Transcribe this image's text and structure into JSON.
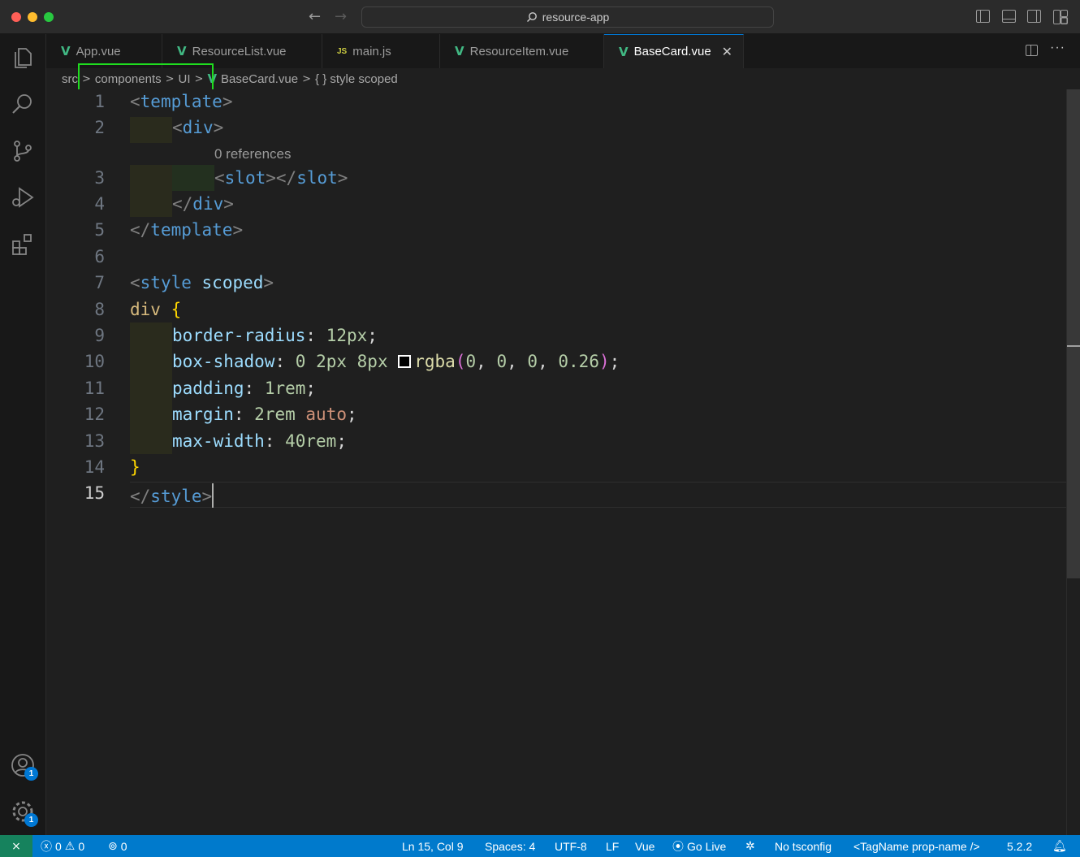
{
  "titlebar": {
    "search_text": "resource-app"
  },
  "tabs": [
    {
      "label": "App.vue",
      "icon": "vue"
    },
    {
      "label": "ResourceList.vue",
      "icon": "vue"
    },
    {
      "label": "main.js",
      "icon": "js"
    },
    {
      "label": "ResourceItem.vue",
      "icon": "vue"
    },
    {
      "label": "BaseCard.vue",
      "icon": "vue",
      "active": true
    }
  ],
  "icon_text": {
    "js": "JS",
    "close": "✕",
    "more": "···"
  },
  "breadcrumb": {
    "items": [
      "src",
      "components",
      "UI",
      "BaseCard.vue",
      "{ } style scoped"
    ],
    "separator": ">"
  },
  "editor": {
    "line_numbers": [
      "1",
      "2",
      "3",
      "4",
      "5",
      "6",
      "7",
      "8",
      "9",
      "10",
      "11",
      "12",
      "13",
      "14",
      "15"
    ],
    "current_line": "15",
    "codelens": "0 references",
    "tokens": {
      "lt": "<",
      "gt": ">",
      "lts": "</",
      "template": "template",
      "div": "div",
      "slot": "slot",
      "style": "style",
      "scoped": "scoped",
      "open_brace": "{",
      "close_brace": "}",
      "border_radius": "border-radius",
      "box_shadow": "box-shadow",
      "padding": "padding",
      "margin": "margin",
      "max_width": "max-width",
      "colon": ":",
      "semi": ";",
      "comma": ",",
      "v_12px": "12px",
      "v_0": "0",
      "v_2px": "2px",
      "v_8px": "8px",
      "rgba": "rgba",
      "lparen": "(",
      "rparen": ")",
      "v_0b": "0",
      "v_0c": "0",
      "v_026": "0.26",
      "v_1rem": "1rem",
      "v_2rem": "2rem",
      "auto": "auto",
      "v_40rem": "40rem"
    }
  },
  "statusbar": {
    "errors": "0",
    "warnings": "0",
    "ports": "0",
    "position": "Ln 15, Col 9",
    "spaces": "Spaces: 4",
    "encoding": "UTF-8",
    "eol": "LF",
    "language": "Vue",
    "golive": "Go Live",
    "tsconfig": "No tsconfig",
    "tagname": "<TagName prop-name />",
    "version": "5.2.2"
  },
  "activity_badges": {
    "accounts": "1",
    "manage": "1"
  },
  "colors": {
    "accent": "#007acc",
    "highlight_box": "#1fdc1f",
    "vue_green": "#41b883"
  }
}
